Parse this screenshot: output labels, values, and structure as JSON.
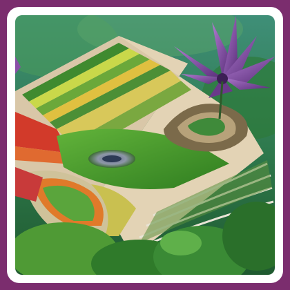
{
  "image": {
    "subject": "surreal-garden-book",
    "frame_color": "#7b2d6e",
    "card_color": "#ffffff"
  }
}
